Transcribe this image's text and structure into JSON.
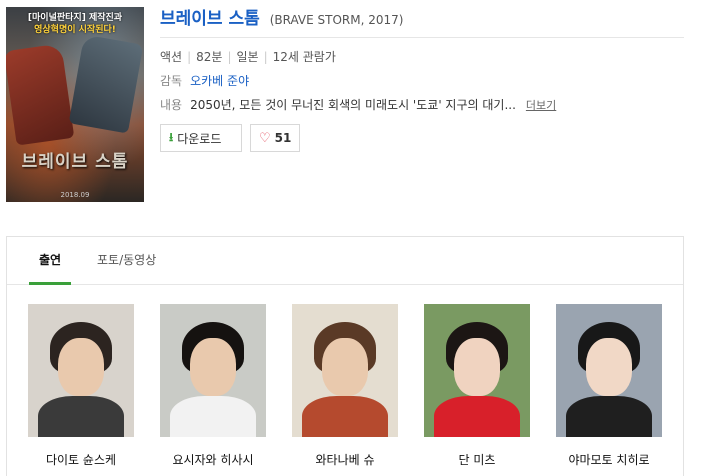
{
  "poster": {
    "tagline_1": "[마이널판타지] 제작진과",
    "tagline_2": "영상혁명이 시작된다!",
    "title_art": "브레이브 스톰",
    "date": "2018.09"
  },
  "movie": {
    "title": "브레이브 스톰",
    "subtitle": "(BRAVE STORM, 2017)",
    "genre": "액션",
    "runtime": "82분",
    "country": "일본",
    "rating": "12세 관람가",
    "director_label": "감독",
    "director": "오카베 준야",
    "plot_label": "내용",
    "plot": "2050년, 모든 것이 무너진 회색의 미래도시 '도쿄' 지구의 대기...",
    "more_label": "더보기"
  },
  "actions": {
    "download_label": "다운로드",
    "like_count": "51"
  },
  "tabs": [
    {
      "label": "출연",
      "active": true
    },
    {
      "label": "포토/동영상",
      "active": false
    }
  ],
  "cast": [
    {
      "name": "다이토 슌스케"
    },
    {
      "name": "요시자와 히사시"
    },
    {
      "name": "와타나베 슈"
    },
    {
      "name": "단 미츠"
    },
    {
      "name": "야마모토 치히로"
    }
  ],
  "colors": {
    "accent_green": "#3aa03a",
    "link_blue": "#1a60c4",
    "heart_red": "#e34a5a"
  }
}
